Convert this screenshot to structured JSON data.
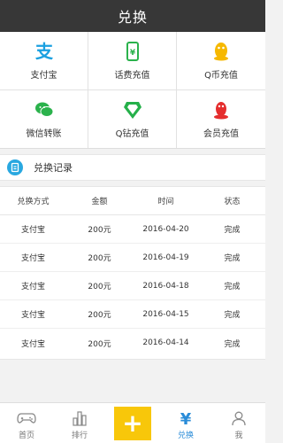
{
  "header": {
    "title": "兑换"
  },
  "services": [
    {
      "label": "支付宝",
      "icon": "alipay-icon",
      "color": "#1aa0e0"
    },
    {
      "label": "话费充值",
      "icon": "phone-icon",
      "color": "#2bb24c"
    },
    {
      "label": "Q币充值",
      "icon": "qq-coin-icon",
      "color": "#f6b800"
    },
    {
      "label": "微信转账",
      "icon": "wechat-icon",
      "color": "#2bb24c"
    },
    {
      "label": "Q钻充值",
      "icon": "q-diamond-icon",
      "color": "#25b04a"
    },
    {
      "label": "会员充值",
      "icon": "member-icon",
      "color": "#e52e2e"
    }
  ],
  "records": {
    "title": "兑换记录",
    "columns": [
      "兑换方式",
      "金额",
      "时间",
      "状态"
    ],
    "rows": [
      [
        "支付宝",
        "200元",
        "2016-04-20",
        "完成"
      ],
      [
        "支付宝",
        "200元",
        "2016-04-19",
        "完成"
      ],
      [
        "支付宝",
        "200元",
        "2016-04-18",
        "完成"
      ],
      [
        "支付宝",
        "200元",
        "2016-04-15",
        "完成"
      ],
      [
        "支付宝",
        "200元",
        "2016-04-14",
        "完成"
      ]
    ]
  },
  "nav": {
    "items": [
      {
        "label": "首页",
        "icon": "gamepad-icon"
      },
      {
        "label": "排行",
        "icon": "bar-chart-icon"
      },
      {
        "label": "",
        "icon": "plus-icon"
      },
      {
        "label": "兑换",
        "icon": "yen-icon"
      },
      {
        "label": "我",
        "icon": "user-icon"
      }
    ],
    "plus_symbol": "+",
    "active": "兑换",
    "active_color": "#2a8cd8",
    "accent_color": "#f8c70a"
  }
}
